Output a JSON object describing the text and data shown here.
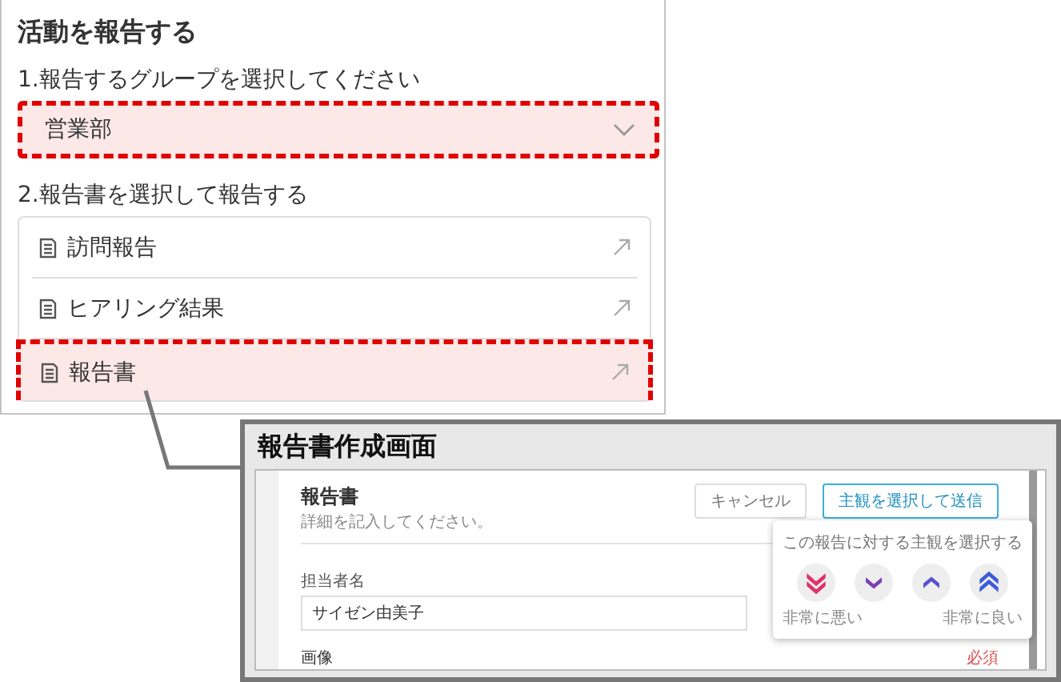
{
  "panel": {
    "title": "活動を報告する",
    "step1_label": "1.報告するグループを選択してください",
    "group_select": {
      "value": "営業部",
      "highlighted": true
    },
    "step2_label": "2.報告書を選択して報告する",
    "reports": [
      {
        "label": "訪問報告",
        "highlighted": false
      },
      {
        "label": "ヒアリング結果",
        "highlighted": false
      },
      {
        "label": "報告書",
        "highlighted": true
      }
    ]
  },
  "callout": {
    "title": "報告書作成画面",
    "form": {
      "title": "報告書",
      "subtitle": "詳細を記入してください。",
      "buttons": [
        {
          "label": "キャンセル",
          "kind": "secondary"
        },
        {
          "label": "主観を選択して送信",
          "kind": "primary"
        }
      ],
      "fields": [
        {
          "label": "担当者名",
          "value": "サイゼン由美子"
        }
      ],
      "image_label": "画像",
      "required": "必須"
    },
    "popover": {
      "title": "この報告に対する主観を選択する",
      "options": [
        {
          "kind": "double-down",
          "color": "#e0306a",
          "label": "非常に悪い"
        },
        {
          "kind": "down",
          "color": "#7b3fb5"
        },
        {
          "kind": "up",
          "color": "#5a4fd0"
        },
        {
          "kind": "double-up",
          "color": "#3b5bdb",
          "label": "非常に良い"
        }
      ]
    }
  }
}
